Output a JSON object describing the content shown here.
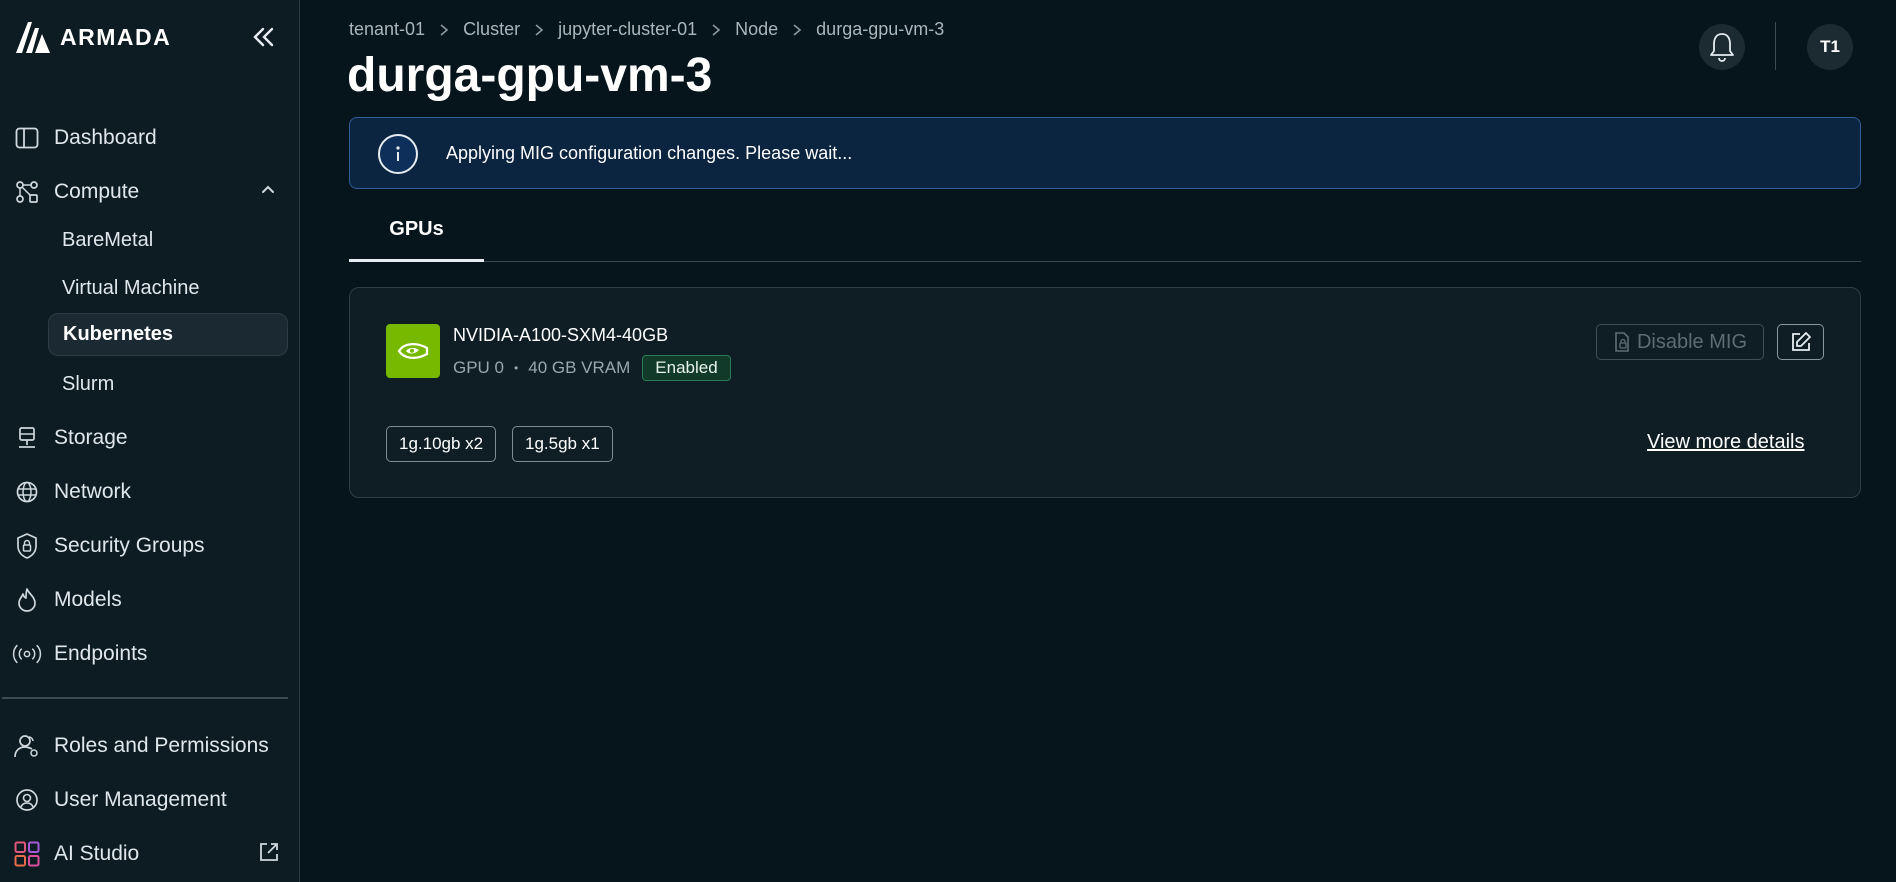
{
  "brand": {
    "name": "ARMADA"
  },
  "sidebar": {
    "items": [
      {
        "label": "Dashboard",
        "icon": "sidebar-panel-icon"
      },
      {
        "label": "Compute",
        "icon": "compute-nodes-icon",
        "expanded": true,
        "children": [
          {
            "label": "BareMetal"
          },
          {
            "label": "Virtual Machine"
          },
          {
            "label": "Kubernetes",
            "active": true
          },
          {
            "label": "Slurm"
          }
        ]
      },
      {
        "label": "Storage",
        "icon": "storage-icon"
      },
      {
        "label": "Network",
        "icon": "globe-icon"
      },
      {
        "label": "Security Groups",
        "icon": "shield-icon"
      },
      {
        "label": "Models",
        "icon": "flame-icon"
      },
      {
        "label": "Endpoints",
        "icon": "broadcast-icon"
      }
    ],
    "bottom_items": [
      {
        "label": "Roles and Permissions",
        "icon": "users-icon"
      },
      {
        "label": "User Management",
        "icon": "user-circle-icon"
      },
      {
        "label": "AI Studio",
        "icon": "grid-icon",
        "external": true
      }
    ]
  },
  "breadcrumb": [
    "tenant-01",
    "Cluster",
    "jupyter-cluster-01",
    "Node",
    "durga-gpu-vm-3"
  ],
  "page": {
    "title": "durga-gpu-vm-3"
  },
  "header": {
    "avatar_initials": "T1"
  },
  "banner": {
    "text": "Applying MIG configuration changes. Please wait...",
    "icon": "info-icon",
    "accent": "#2d5e96"
  },
  "tabs": [
    {
      "label": "GPUs",
      "active": true
    }
  ],
  "gpu": {
    "name": "NVIDIA-A100-SXM4-40GB",
    "index_label": "GPU 0",
    "separator": "•",
    "vram": "40 GB VRAM",
    "status": "Enabled",
    "status_color": "#2a7a55",
    "logo_color": "#76b900",
    "disable_label": "Disable MIG",
    "profiles": [
      "1g.10gb x2",
      "1g.5gb x1"
    ],
    "view_more": "View more details"
  }
}
